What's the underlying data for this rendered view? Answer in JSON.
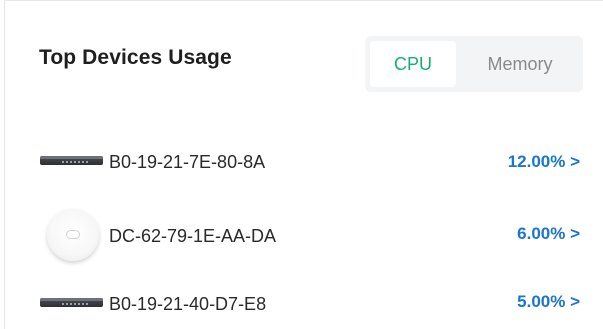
{
  "widget": {
    "title": "Top Devices Usage",
    "tabs": {
      "cpu_label": "CPU",
      "memory_label": "Memory",
      "selected": "CPU"
    }
  },
  "devices": [
    {
      "name": "B0-19-21-7E-80-8A",
      "value": "12.00% >",
      "icon": "switch-device-icon"
    },
    {
      "name": "DC-62-79-1E-AA-DA",
      "value": "6.00% >",
      "icon": "access-point-icon"
    },
    {
      "name": "B0-19-21-40-D7-E8",
      "value": "5.00% >",
      "icon": "switch-device-icon"
    }
  ],
  "colors": {
    "accent_green": "#14b06e",
    "link_blue": "#1a74d1"
  }
}
